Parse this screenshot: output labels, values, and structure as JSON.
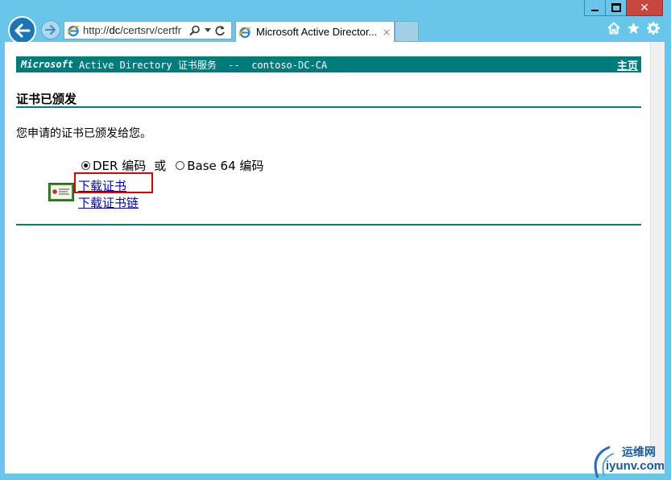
{
  "browser": {
    "address": {
      "scheme": "http://",
      "host": "dc",
      "path": "/certsrv/certfr"
    },
    "tab": {
      "title": "Microsoft Active Director...",
      "close": "×"
    },
    "window_buttons": {
      "close": "✕"
    }
  },
  "page": {
    "banner": {
      "brand": "Microsoft",
      "service": "Active Directory 证书服务  --  contoso-DC-CA",
      "home_link": "主页"
    },
    "heading": "证书已颁发",
    "message": "您申请的证书已颁发给您。",
    "encoding_options": [
      {
        "label": "DER 编码",
        "selected": true
      },
      {
        "label": "Base 64 编码",
        "selected": false
      }
    ],
    "or_text": "或",
    "download_cert": "下载证书",
    "download_chain": "下载证书链"
  },
  "watermark": {
    "cn": "运维网",
    "en": "iyunv.com"
  },
  "colors": {
    "accent": "#007b7b",
    "link": "#0000cc",
    "highlight": "#e00000",
    "chrome": "#67c6ea"
  }
}
